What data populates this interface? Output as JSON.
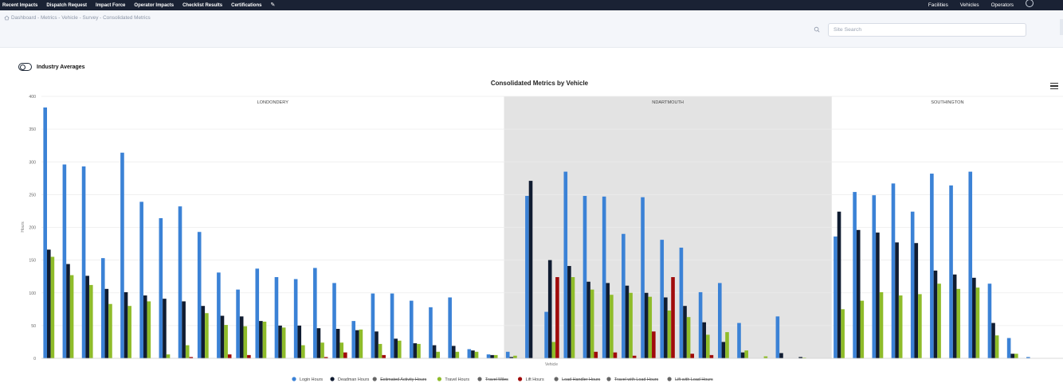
{
  "nav": {
    "left_items": [
      "Recent Impacts",
      "Dispatch Request",
      "Impact Force",
      "Operator Impacts",
      "Checklist Results",
      "Certifications"
    ],
    "right_items": [
      "Facilities",
      "Vehicles",
      "Operators"
    ]
  },
  "breadcrumb": "Dashboard - Metrics - Vehicle - Survey - Consolidated Metrics",
  "search": {
    "placeholder": "Site Search",
    "value": ""
  },
  "toggle": {
    "label": "Industry Averages",
    "on": false
  },
  "chart_data": {
    "type": "bar",
    "title": "Consolidated Metrics by Vehicle",
    "xlabel": "Vehicle",
    "ylabel": "Hours",
    "ylim": [
      0,
      400
    ],
    "yticks": [
      0,
      50,
      100,
      150,
      200,
      250,
      300,
      350,
      400
    ],
    "grid": true,
    "legend_position": "bottom-center",
    "groups": [
      {
        "label": "LONDONDERY",
        "start": 0,
        "end": 24,
        "shaded": false
      },
      {
        "label": "NDARTMOUTH",
        "start": 24,
        "end": 41,
        "shaded": true
      },
      {
        "label": "SOUTHINGTON",
        "start": 41,
        "end": 53,
        "shaded": false
      }
    ],
    "categories_count": 53,
    "series": [
      {
        "name": "Login Hours",
        "color": "#3b82d6",
        "visible": true,
        "values": [
          383,
          296,
          293,
          153,
          314,
          239,
          214,
          232,
          193,
          131,
          105,
          137,
          124,
          121,
          138,
          115,
          57,
          99,
          99,
          88,
          78,
          93,
          14,
          6,
          10,
          248,
          71,
          285,
          248,
          247,
          190,
          246,
          181,
          169,
          101,
          115,
          54,
          0,
          64,
          0,
          0,
          186,
          254,
          249,
          267,
          224,
          282,
          264,
          285,
          114,
          31,
          2,
          0
        ]
      },
      {
        "name": "Deadman Hours",
        "color": "#101c31",
        "visible": true,
        "values": [
          166,
          144,
          126,
          106,
          101,
          96,
          91,
          87,
          80,
          65,
          64,
          57,
          50,
          50,
          46,
          45,
          43,
          41,
          30,
          23,
          20,
          19,
          12,
          5,
          2,
          271,
          150,
          141,
          117,
          115,
          111,
          100,
          93,
          80,
          55,
          25,
          9,
          0,
          8,
          2,
          0,
          224,
          196,
          192,
          177,
          176,
          134,
          128,
          123,
          54,
          7,
          0,
          0
        ]
      },
      {
        "name": "Estimated Activity Hours",
        "color": "#555555",
        "visible": false,
        "values": []
      },
      {
        "name": "Travel Hours",
        "color": "#8fbc2a",
        "visible": true,
        "values": [
          155,
          127,
          112,
          83,
          80,
          87,
          6,
          20,
          69,
          51,
          49,
          56,
          47,
          20,
          24,
          24,
          44,
          22,
          27,
          22,
          10,
          10,
          10,
          5,
          4,
          0,
          25,
          124,
          105,
          97,
          100,
          94,
          73,
          63,
          36,
          40,
          12,
          3,
          0,
          1,
          0,
          75,
          88,
          101,
          96,
          98,
          114,
          106,
          108,
          35,
          7,
          0,
          0
        ]
      },
      {
        "name": "Travel Miles",
        "color": "#555555",
        "visible": false,
        "values": []
      },
      {
        "name": "Lift Hours",
        "color": "#a00b0b",
        "visible": true,
        "values": [
          0,
          0,
          0,
          0,
          0,
          0,
          0,
          2,
          0,
          6,
          5,
          0,
          0,
          0,
          2,
          9,
          0,
          5,
          0,
          0,
          0,
          0,
          0,
          0,
          0,
          0,
          124,
          0,
          10,
          9,
          4,
          41,
          124,
          7,
          5,
          0,
          0,
          0,
          0,
          0,
          0,
          0,
          0,
          0,
          0,
          0,
          0,
          0,
          0,
          0,
          0,
          0,
          0
        ]
      },
      {
        "name": "Load Handler Hours",
        "color": "#555555",
        "visible": false,
        "values": []
      },
      {
        "name": "Travel with Load Hours",
        "color": "#555555",
        "visible": false,
        "values": []
      },
      {
        "name": "Lift with Load Hours",
        "color": "#555555",
        "visible": false,
        "values": []
      }
    ]
  }
}
